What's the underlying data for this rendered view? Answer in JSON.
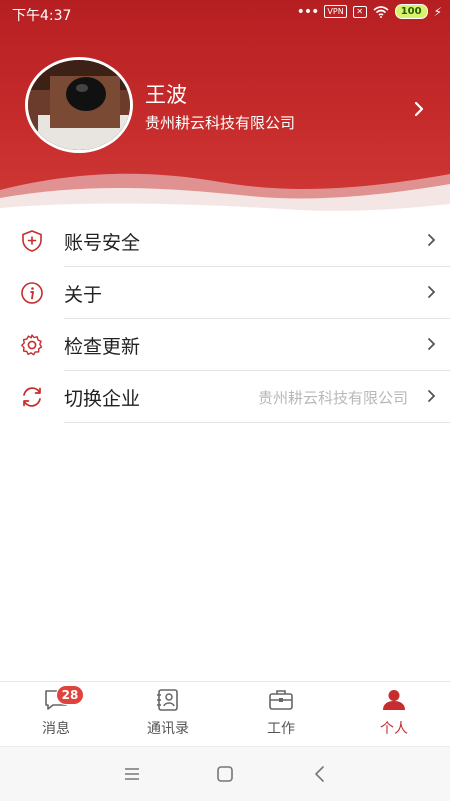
{
  "status_bar": {
    "time": "下午4:37",
    "vpn": "VPN",
    "battery": "100"
  },
  "profile": {
    "name": "王波",
    "company": "贵州耕云科技有限公司"
  },
  "menu": [
    {
      "label": "账号安全",
      "icon": "shield-plus-icon",
      "value": ""
    },
    {
      "label": "关于",
      "icon": "info-icon",
      "value": ""
    },
    {
      "label": "检查更新",
      "icon": "gear-icon",
      "value": ""
    },
    {
      "label": "切换企业",
      "icon": "refresh-icon",
      "value": "贵州耕云科技有限公司"
    }
  ],
  "tabs": [
    {
      "label": "消息",
      "icon": "chat-icon",
      "badge": "28"
    },
    {
      "label": "通讯录",
      "icon": "contacts-icon"
    },
    {
      "label": "工作",
      "icon": "briefcase-icon"
    },
    {
      "label": "个人",
      "icon": "person-icon",
      "active": true
    }
  ],
  "colors": {
    "brand_red": "#c62d2d",
    "badge_red": "#e0433c"
  }
}
